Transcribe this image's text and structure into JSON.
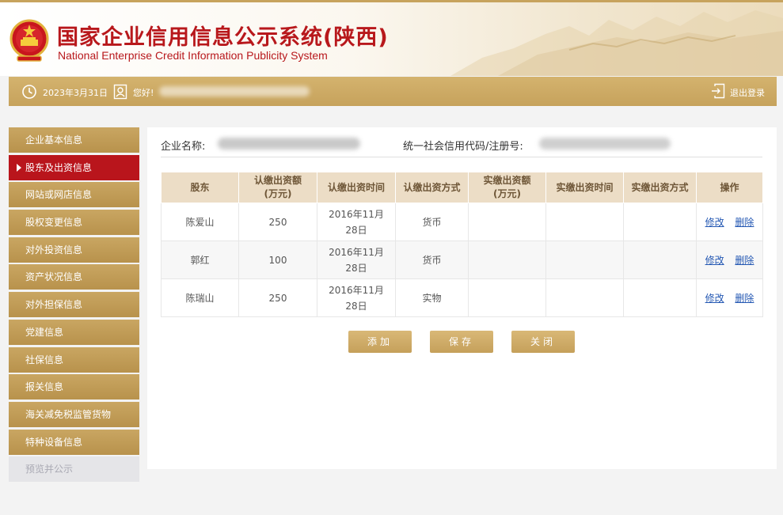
{
  "header": {
    "title_cn": "国家企业信用信息公示系统(陕西)",
    "title_en": "National Enterprise Credit Information Publicity System"
  },
  "topbar": {
    "date": "2023年3月31日",
    "greeting": "您好!",
    "logout": "退出登录",
    "clock_icon": "clock-icon",
    "user_icon": "user-icon",
    "logout_icon": "logout-icon"
  },
  "sidebar": {
    "items": [
      {
        "label": "企业基本信息",
        "state": "normal"
      },
      {
        "label": "股东及出资信息",
        "state": "active"
      },
      {
        "label": "网站或网店信息",
        "state": "normal"
      },
      {
        "label": "股权变更信息",
        "state": "normal"
      },
      {
        "label": "对外投资信息",
        "state": "normal"
      },
      {
        "label": "资产状况信息",
        "state": "normal"
      },
      {
        "label": "对外担保信息",
        "state": "normal"
      },
      {
        "label": "党建信息",
        "state": "normal"
      },
      {
        "label": "社保信息",
        "state": "normal"
      },
      {
        "label": "报关信息",
        "state": "normal"
      },
      {
        "label": "海关减免税监管货物",
        "state": "normal"
      },
      {
        "label": "特种设备信息",
        "state": "normal"
      },
      {
        "label": "预览并公示",
        "state": "disabled"
      }
    ]
  },
  "main": {
    "company_label": "企业名称:",
    "code_label": "统一社会信用代码/注册号:",
    "table": {
      "headers": [
        "股东",
        "认缴出资额\n(万元)",
        "认缴出资时间",
        "认缴出资方式",
        "实缴出资额\n(万元)",
        "实缴出资时间",
        "实缴出资方式",
        "操作"
      ],
      "rows": [
        {
          "holder": "陈爱山",
          "amount": "250",
          "date": "2016年11月28日",
          "method": "货币",
          "paid_amount": "",
          "paid_date": "",
          "paid_method": "",
          "edit": "修改",
          "delete": "删除"
        },
        {
          "holder": "郭红",
          "amount": "100",
          "date": "2016年11月28日",
          "method": "货币",
          "paid_amount": "",
          "paid_date": "",
          "paid_method": "",
          "edit": "修改",
          "delete": "删除"
        },
        {
          "holder": "陈瑞山",
          "amount": "250",
          "date": "2016年11月28日",
          "method": "实物",
          "paid_amount": "",
          "paid_date": "",
          "paid_method": "",
          "edit": "修改",
          "delete": "删除"
        }
      ]
    },
    "buttons": {
      "add": "添加",
      "save": "保存",
      "close": "关闭"
    }
  },
  "colors": {
    "brand_red": "#b8181c",
    "gold": "#c6a25c",
    "active_red": "#b9151c",
    "link_blue": "#2458b3",
    "header_cell": "#ecddc6"
  }
}
